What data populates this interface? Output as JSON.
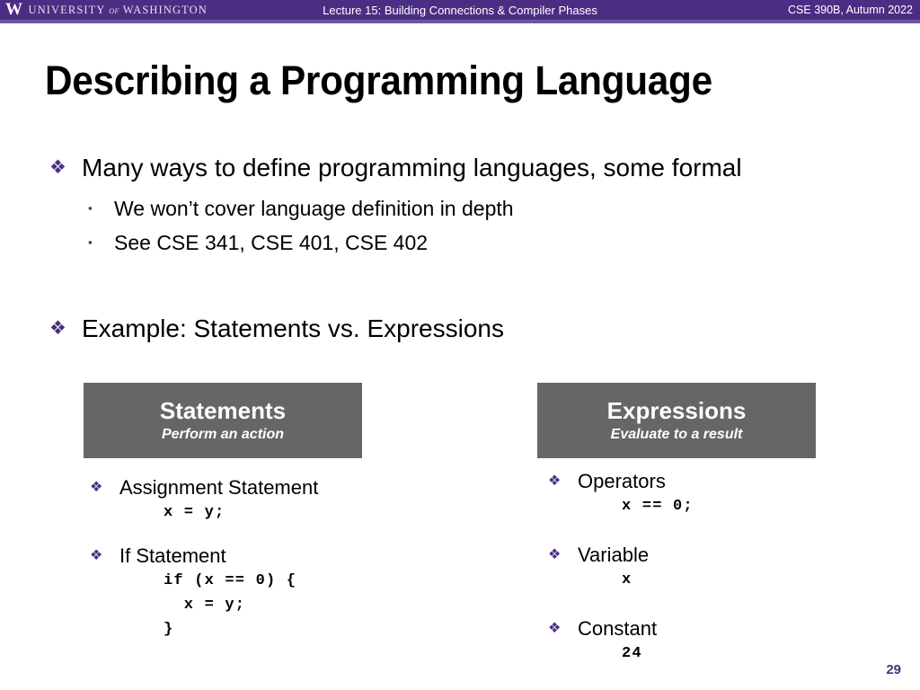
{
  "header": {
    "brand_mark": "W",
    "brand_university": "UNIVERSITY",
    "brand_of": "of",
    "brand_washington": "WASHINGTON",
    "lecture_title": "Lecture 15: Building Connections & Compiler Phases",
    "course": "CSE 390B, Autumn 2022",
    "bar_color": "#4b2e83",
    "accent_color": "#6f56a0"
  },
  "slide": {
    "title": "Describing a Programming Language",
    "number": "29",
    "bullet_diamond": "❖",
    "bullet_square": "▪",
    "bullet_color": "#4b2e83"
  },
  "bullets": [
    {
      "level": 1,
      "marker": "❖",
      "text": "Many ways to define programming languages, some formal"
    },
    {
      "level": 2,
      "marker": "▪",
      "text": "We won’t cover language definition in depth"
    },
    {
      "level": 2,
      "marker": "▪",
      "text": "See CSE 341, CSE 401, CSE 402"
    },
    {
      "level": 1,
      "marker": "❖",
      "text": "Example: Statements vs. Expressions"
    }
  ],
  "comparison": {
    "box_color": "#666666",
    "left": {
      "title": "Statements",
      "subtitle": "Perform an action",
      "items": [
        {
          "marker": "❖",
          "label": "Assignment Statement",
          "code": "x = y;"
        },
        {
          "marker": "❖",
          "label": "If Statement",
          "code": "if (x == 0) {\n  x = y;\n}"
        }
      ]
    },
    "right": {
      "title": "Expressions",
      "subtitle": "Evaluate to a result",
      "items": [
        {
          "marker": "❖",
          "label": "Operators",
          "code": "x == 0;"
        },
        {
          "marker": "❖",
          "label": "Variable",
          "code": "x"
        },
        {
          "marker": "❖",
          "label": "Constant",
          "code": "24"
        }
      ]
    }
  }
}
